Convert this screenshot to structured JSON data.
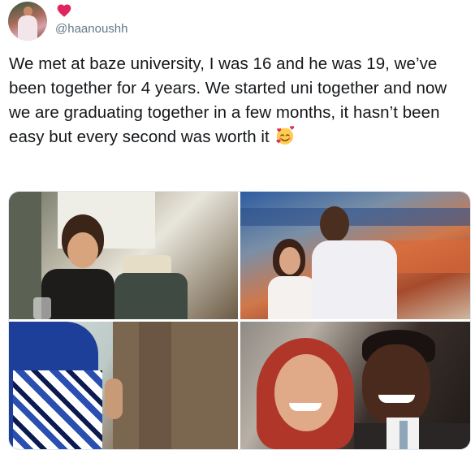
{
  "author": {
    "handle": "@haanoushh",
    "avatar_icon": "profile-photo-avatar",
    "badge_icon": "red-heart-icon",
    "badge_color": "#e0245e"
  },
  "tweet": {
    "text": "We met at baze university, I was 16 and he was 19, we’ve been together for 4 years. We started uni together and now we are graduating together in a few months, it hasn’t been easy but every second was worth it",
    "emoji_icon": "smiling-face-with-hearts-emoji"
  },
  "media": {
    "photos": [
      {
        "description_icon": "photo-couple-dinner"
      },
      {
        "description_icon": "photo-couple-mural"
      },
      {
        "description_icon": "photo-couple-traditional-attire"
      },
      {
        "description_icon": "photo-couple-closeup"
      }
    ]
  }
}
